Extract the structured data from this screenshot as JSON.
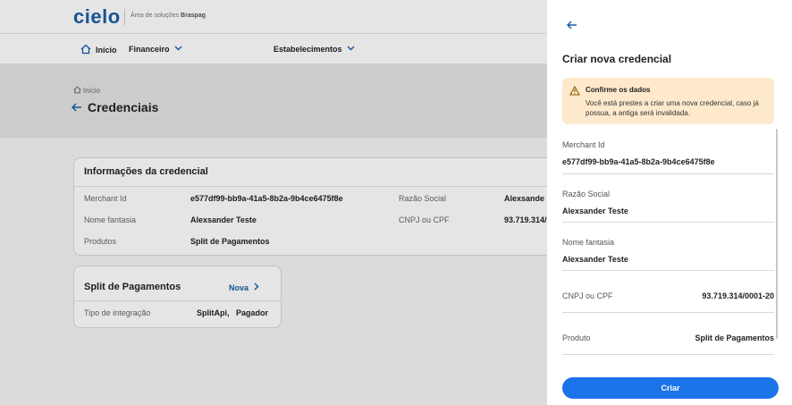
{
  "header": {
    "logo": "cielo",
    "subtitle_prefix": "Área de soluções",
    "subtitle_brand": "Braspag"
  },
  "nav": {
    "home": "Início",
    "financeiro": "Financeiro",
    "estabelecimentos": "Estabelecimentos"
  },
  "page": {
    "breadcrumb": "Início",
    "title": "Credenciais"
  },
  "credential_card": {
    "title": "Informações da credencial",
    "merchant_label": "Merchant Id",
    "merchant_value": "e577df99-bb9a-41a5-8b2a-9b4ce6475f8e",
    "nome_label": "Nome fantasia",
    "nome_value": "Alexsander Teste",
    "produtos_label": "Produtos",
    "produtos_value": "Split de Pagamentos",
    "razao_label": "Razão Social",
    "razao_value": "Alexsande",
    "cnpj_label": "CNPJ ou CPF",
    "cnpj_value": "93.719.314/"
  },
  "split_card": {
    "title": "Split de Pagamentos",
    "nova_label": "Nova",
    "tipo_label": "Tipo de integração",
    "tipo_value_1": "SplitApi,",
    "tipo_value_2": "Pagador"
  },
  "drawer": {
    "title": "Criar nova credencial",
    "alert_title": "Confirme os dados",
    "alert_text": "Você está prestes a criar uma nova credencial, caso já possua, a antiga será invalidada.",
    "merchant_label": "Merchant Id",
    "merchant_value": "e577df99-bb9a-41a5-8b2a-9b4ce6475f8e",
    "razao_label": "Razão Social",
    "razao_value": "Alexsander Teste",
    "nome_label": "Nome fantasia",
    "nome_value": "Alexsander Teste",
    "cnpj_label": "CNPJ ou CPF",
    "cnpj_value": "93.719.314/0001-20",
    "produto_label": "Produto",
    "produto_value": "Split de Pagamentos",
    "submit_label": "Criar"
  },
  "colors": {
    "brand": "#1a5da8",
    "primary_button": "#1a73e8",
    "alert_bg": "#ffe9cc"
  }
}
